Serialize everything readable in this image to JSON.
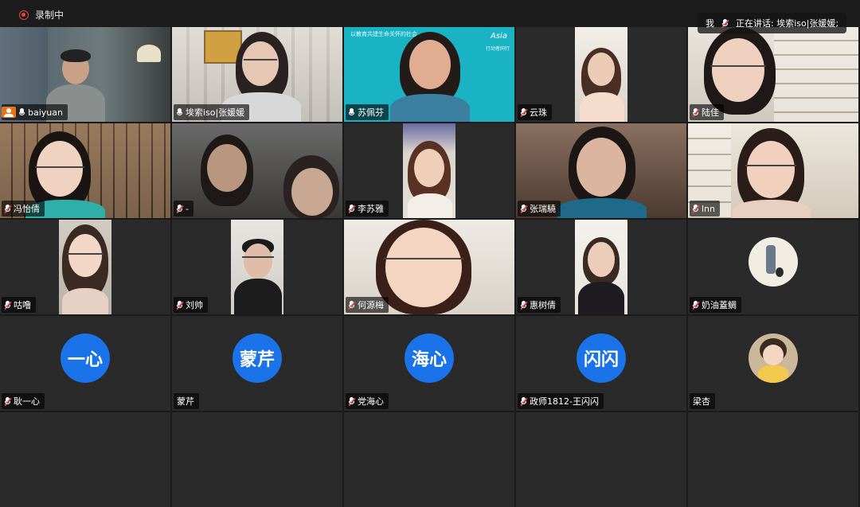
{
  "recording": {
    "label": "录制中"
  },
  "speaking_banner": {
    "prefix": "我",
    "text": "正在讲话: 埃索iso|张媛媛;"
  },
  "brand_banner": {
    "tagline": "以教育共建生命关怀的社会",
    "logo_text": "Asia",
    "logo_sub": "行动者同行"
  },
  "participants": [
    {
      "name": "baiyuan",
      "muted": false,
      "host": true
    },
    {
      "name": "埃索iso|张媛媛",
      "muted": false,
      "active": true
    },
    {
      "name": "苏佩芬",
      "muted": false
    },
    {
      "name": "云珠",
      "muted": true
    },
    {
      "name": "陆佳",
      "muted": true
    },
    {
      "name": "冯怡倩",
      "muted": true
    },
    {
      "name": "-",
      "muted": true
    },
    {
      "name": "李苏雅",
      "muted": true
    },
    {
      "name": "张瑞驍",
      "muted": true
    },
    {
      "name": "lnn",
      "muted": true
    },
    {
      "name": "咕噜",
      "muted": true
    },
    {
      "name": "刘帅",
      "muted": true
    },
    {
      "name": "何源梅",
      "muted": true
    },
    {
      "name": "惠树倩",
      "muted": true
    },
    {
      "name": "奶油蓋鲷",
      "muted": true
    },
    {
      "name": "耿一心",
      "muted": true,
      "avatar_text": "一心"
    },
    {
      "name": "蒙芹",
      "muted": false,
      "avatar_text": "蒙芹"
    },
    {
      "name": "党海心",
      "muted": true,
      "avatar_text": "海心"
    },
    {
      "name": "政师1812-王闪闪",
      "muted": true,
      "avatar_text": "闪闪"
    },
    {
      "name": "梁杏",
      "muted": false
    }
  ],
  "colors": {
    "accent_blue": "#1a73e8",
    "active_border": "#2fd169",
    "muted_red": "#e04848"
  }
}
